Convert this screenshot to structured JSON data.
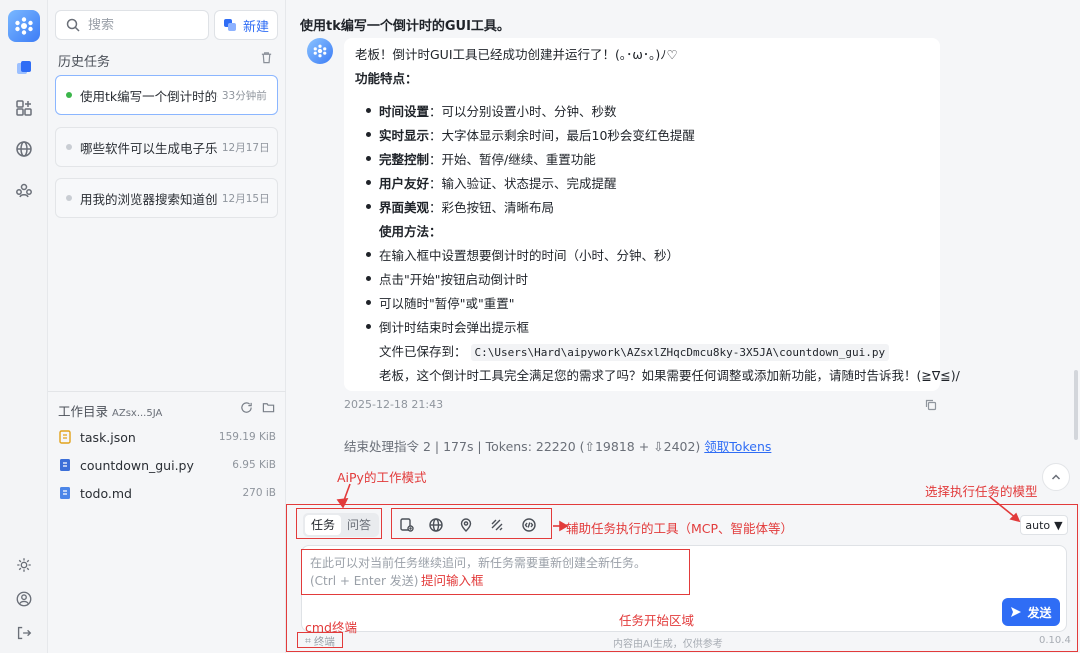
{
  "sidebar": {
    "search_placeholder": "搜索",
    "new_label": "新建",
    "history_title": "历史任务",
    "tasks": [
      {
        "title": "使用tk编写一个倒计时的GUI工具。",
        "time": "33分钟前"
      },
      {
        "title": "哪些软件可以生成电子乐谱",
        "time": "12月17日"
      },
      {
        "title": "用我的浏览器搜索知道创宇",
        "time": "12月15日"
      }
    ],
    "dir_title": "工作目录",
    "dir_name": "AZsx...5JA",
    "files": [
      {
        "name": "task.json",
        "size": "159.19 KiB"
      },
      {
        "name": "countdown_gui.py",
        "size": "6.95 KiB"
      },
      {
        "name": "todo.md",
        "size": "270 iB"
      }
    ]
  },
  "chat": {
    "title": "使用tk编写一个倒计时的GUI工具。",
    "intro": "老板！倒计时GUI工具已经成功创建并运行了！(｡･ω･｡)ﾉ♡",
    "features_title": "功能特点：",
    "features": [
      {
        "k": "时间设置",
        "v": "：可以分别设置小时、分钟、秒数"
      },
      {
        "k": "实时显示",
        "v": "：大字体显示剩余时间，最后10秒会变红色提醒"
      },
      {
        "k": "完整控制",
        "v": "：开始、暂停/继续、重置功能"
      },
      {
        "k": "用户友好",
        "v": "：输入验证、状态提示、完成提醒"
      },
      {
        "k": "界面美观",
        "v": "：彩色按钮、清晰布局"
      }
    ],
    "usage_title": "使用方法：",
    "usage": [
      "在输入框中设置想要倒计时的时间（小时、分钟、秒）",
      "点击\"开始\"按钮启动倒计时",
      "可以随时\"暂停\"或\"重置\"",
      "倒计时结束时会弹出提示框"
    ],
    "saved_label": "文件已保存到：",
    "saved_path": "C:\\Users\\Hard\\aipywork\\AZsxlZHqcDmcu8ky-3X5JA\\countdown_gui.py",
    "closing": "老板，这个倒计时工具完全满足您的需求了吗？如果需要任何调整或添加新功能，请随时告诉我！(≧∇≦)/",
    "time": "2025-12-18 21:43",
    "stats": "结束处理指令 2 | 177s | Tokens: 22220 (⇧19818 + ⇩2402)",
    "tokens_link": "领取Tokens"
  },
  "input": {
    "mode_task": "任务",
    "mode_qa": "问答",
    "model": "auto",
    "placeholder": "在此可以对当前任务继续追问，新任务需要重新创建全新任务。\n(Ctrl + Enter 发送)",
    "send_label": "发送",
    "terminal_label": "终端",
    "footer_note": "内容由AI生成，仅供参考",
    "version": "0.10.4"
  },
  "annotations": {
    "work_mode": "AiPy的工作模式",
    "tools": "辅助任务执行的工具（MCP、智能体等）",
    "model_select": "选择执行任务的模型",
    "input_box": "提问输入框",
    "cmd_terminal": "cmd终端",
    "task_area": "任务开始区域",
    "color": "#e23b3b"
  }
}
